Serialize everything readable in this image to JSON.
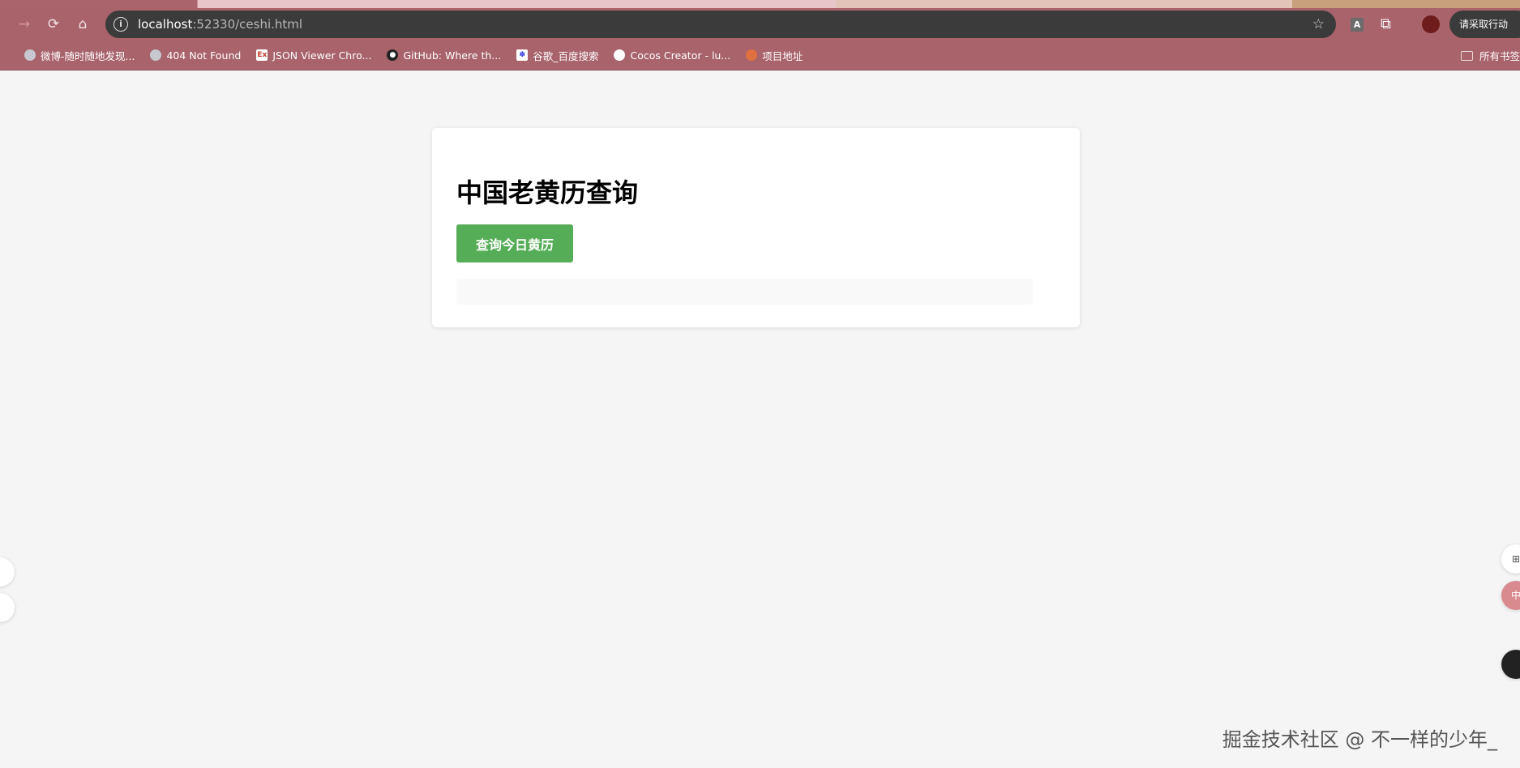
{
  "browser": {
    "url_host": "localhost",
    "url_rest": ":52330/ceshi.html",
    "action_label": "请采取行动",
    "ext_label": "A",
    "bookmarks": [
      {
        "label": "微博-随时随地发现..."
      },
      {
        "label": "404 Not Found"
      },
      {
        "label": "JSON Viewer Chro..."
      },
      {
        "label": "GitHub: Where th..."
      },
      {
        "label": "谷歌_百度搜索"
      },
      {
        "label": "Cocos Creator - lu..."
      },
      {
        "label": "项目地址"
      }
    ],
    "all_bookmarks": "所有书签"
  },
  "page": {
    "title": "中国老黄历查询",
    "query_button": "查询今日黄历",
    "accent": "#56ad57"
  },
  "watermark": "掘金技术社区 @ 不一样的少年_"
}
